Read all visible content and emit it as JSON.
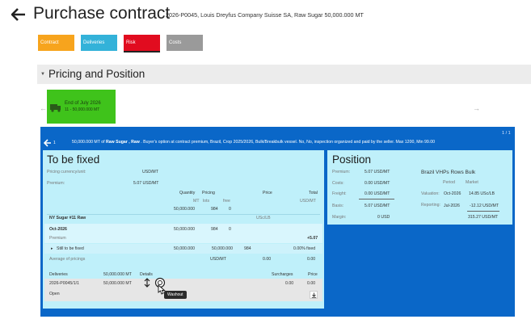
{
  "header": {
    "title": "Purchase contract",
    "subtitle": "2026-P0045, Louis Dreyfus Company Suisse SA, Raw Sugar 50,000.000 MT"
  },
  "tabs": [
    {
      "label": "Contract",
      "color": "#f7a41d"
    },
    {
      "label": "Deliveries",
      "color": "#33b2d9"
    },
    {
      "label": "Risk",
      "color": "#e10c1f"
    },
    {
      "label": "Costs",
      "color": "#9a9a9a"
    }
  ],
  "section": {
    "title": "Pricing and Position"
  },
  "period_card": {
    "line1": "End of July 2026",
    "line2": "11 - 50,000.000 MT",
    "color": "#3fc31b"
  },
  "info": {
    "page": "1 / 1",
    "count": "1",
    "pre": "50,000.000 MT of ",
    "bold": "Raw Sugar , Raw",
    "post": " . Buyer's option at contract premium, Brazil, Crop 2025/2026, Bulk/Breakbulk vessel. No, No, inspection organized and paid by the seller. Max 1200, Min 99.00"
  },
  "to_be_fixed": {
    "title": "To be fixed",
    "pricing_ccy_label": "Pricing currency/unit:",
    "pricing_ccy_value": "USD/MT",
    "premium_label": "Premium:",
    "premium_value": "5.07 USD/MT",
    "col_quantity": "Quantity",
    "col_pricing": "Pricing",
    "col_price": "Price",
    "col_total": "Total",
    "unit_mt": "MT",
    "col_lots": "lots",
    "col_free": "free",
    "unit_total": "USD/MT",
    "total_qty": "50,000.000",
    "total_lots": "984",
    "total_free": "0",
    "market": "NY Sugar #11 Raw",
    "market_unit": "USc/LB",
    "month": "Oct-2026",
    "month_qty": "50,000.000",
    "month_lots": "984",
    "month_free": "0",
    "premium_row_label": "Premium",
    "premium_row_value": "+5.07",
    "still_label": "Still to be fixed",
    "still_qty": "50,000.000",
    "still_qty2": "50,000.000",
    "still_lots": "984",
    "still_fixed": "0.00% fixed",
    "avg_label": "Average of pricings",
    "avg_unit": "USD/MT",
    "avg_price": "0.00",
    "avg_total": "0.00",
    "deliv_label": "Deliveries",
    "deliv_qty": "50,000.000 MT",
    "deliv_details": "Details",
    "deliv_surcharges": "Surcharges",
    "deliv_price": "Price",
    "deliv_ref": "2026-P0045/1/1",
    "deliv_ref_qty": "50,000.000 MT",
    "deliv_sur_val": "0.00",
    "deliv_price_val": "0.00",
    "deliv_status": "Open",
    "tooltip": "Washout"
  },
  "position": {
    "title": "Position",
    "premium_label": "Premium:",
    "premium_value": "5.07 USD/MT",
    "costs_label": "Costs:",
    "costs_value": "0.00 USD/MT",
    "freight_label": "Freight:",
    "freight_value": "0.00 USD/MT",
    "basis_label": "Basis:",
    "basis_value": "5.07 USD/MT",
    "margin_label": "Margin:",
    "margin_value": "0 USD",
    "market_title": "Brazil VHPs Rows Bulk",
    "col_period": "Period",
    "col_market": "Market",
    "valuation_label": "Valuation:",
    "valuation_period": "Oct-2026",
    "valuation_value": "14.85  USc/LB",
    "reporting_label": "Reporting:",
    "reporting_period": "Jul-2026",
    "reporting_value": "-12.12  USD/MT",
    "reporting_value2": "315.27  USD/MT"
  },
  "colors": {
    "panel": "#0a67c8",
    "light_panel": "#bff0fa",
    "green": "#3fc31b"
  }
}
